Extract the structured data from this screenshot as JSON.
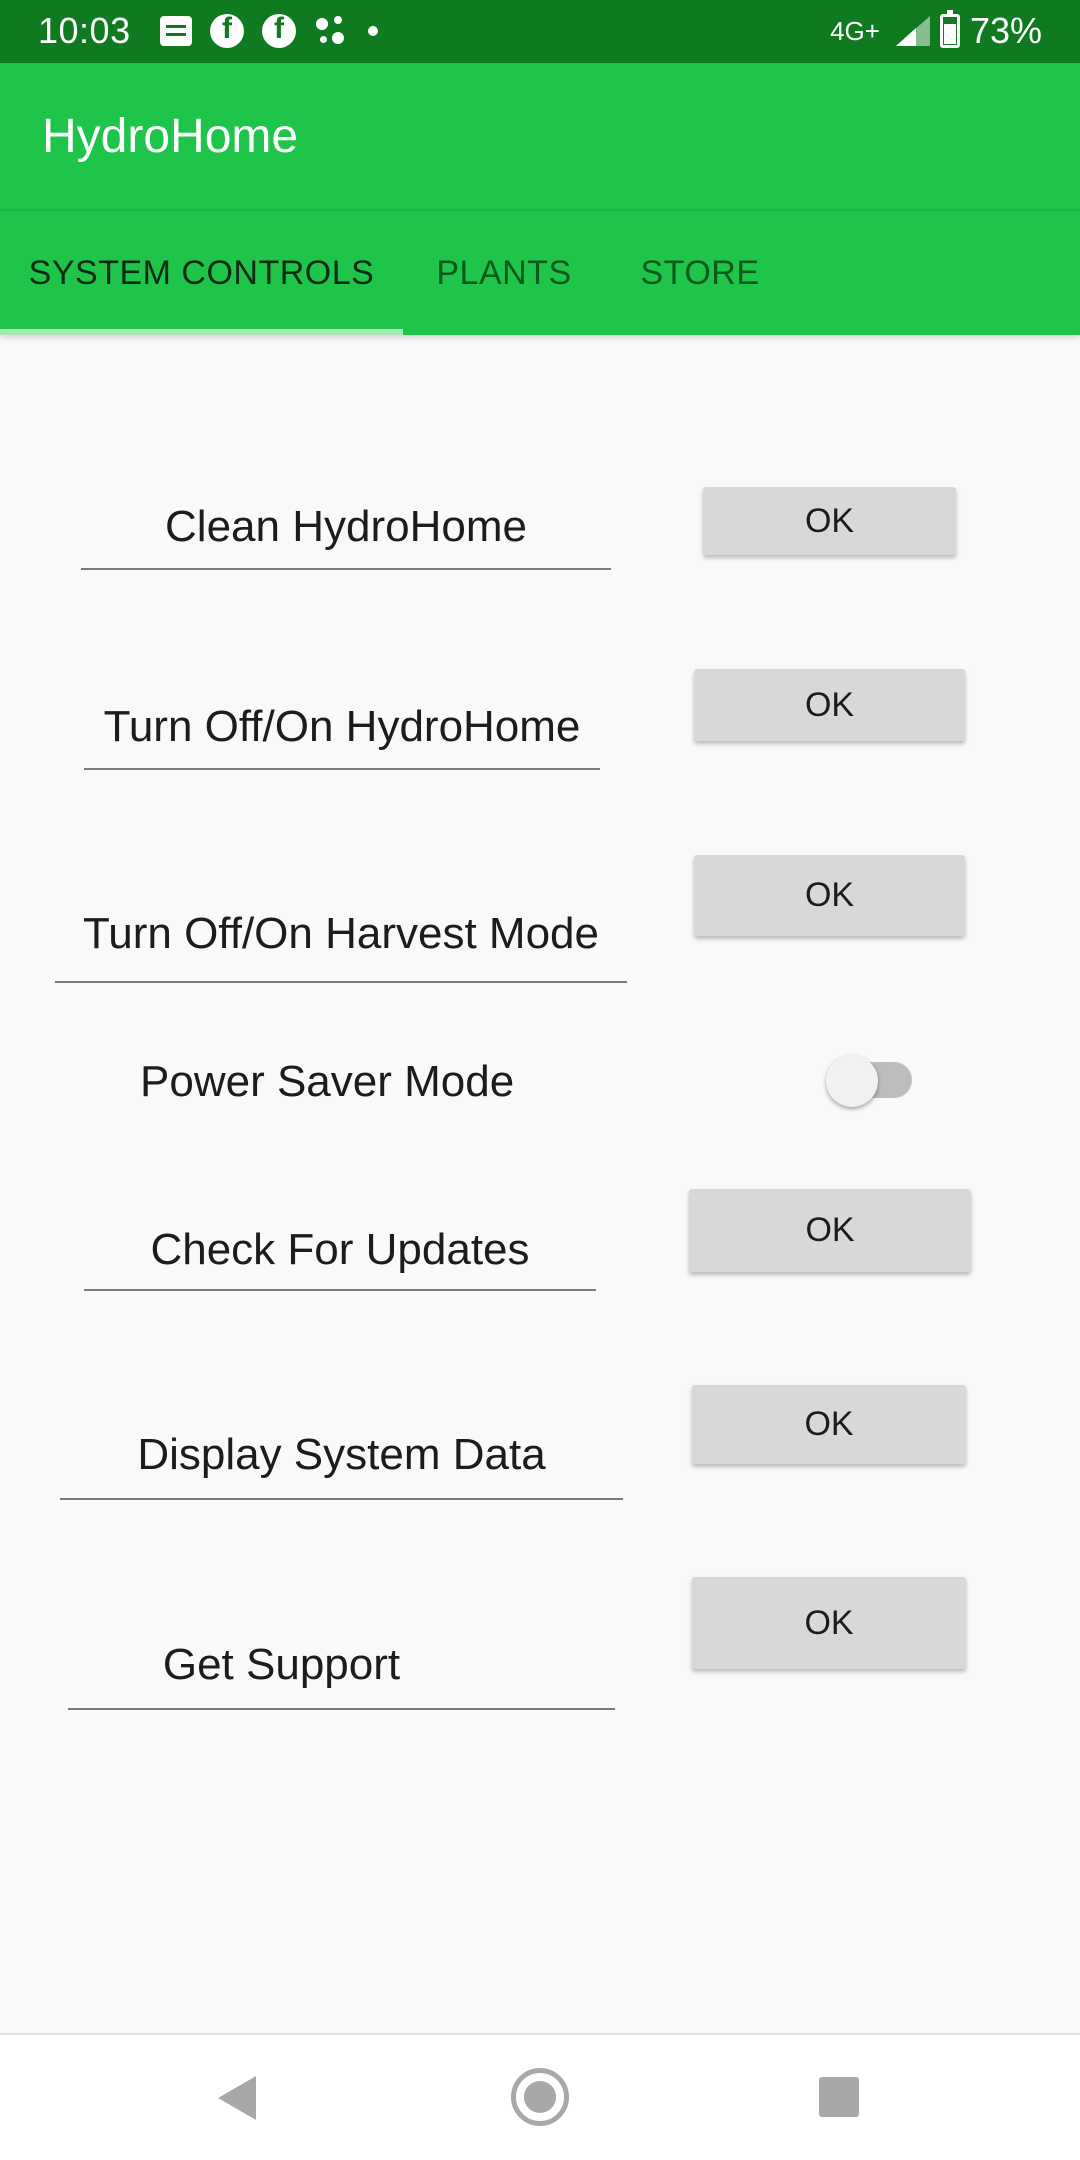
{
  "status_bar": {
    "time": "10:03",
    "network": "4G+",
    "battery": "73%",
    "icons": [
      "message-icon",
      "facebook-icon",
      "facebook-icon",
      "assistant-dots-icon",
      "notification-dot-icon",
      "signal-icon",
      "battery-icon"
    ]
  },
  "app_bar": {
    "title": "HydroHome"
  },
  "tabs": [
    {
      "label": "SYSTEM CONTROLS",
      "active": true
    },
    {
      "label": "PLANTS",
      "active": false
    },
    {
      "label": "STORE",
      "active": false
    }
  ],
  "controls": [
    {
      "label": "Clean HydroHome",
      "button": "OK"
    },
    {
      "label": "Turn Off/On HydroHome",
      "button": "OK"
    },
    {
      "label": "Turn Off/On Harvest Mode",
      "button": "OK"
    },
    {
      "label": "Power Saver Mode",
      "switch_on": false
    },
    {
      "label": "Check For Updates",
      "button": "OK"
    },
    {
      "label": "Display System Data",
      "button": "OK"
    },
    {
      "label": "Get Support",
      "button": "OK"
    }
  ],
  "nav_bar": {
    "icons": [
      "back-icon",
      "home-icon",
      "recents-icon"
    ]
  },
  "colors": {
    "status_bar": "#0f7a20",
    "app_bar": "#1fc54a",
    "background": "#f9f9f9",
    "button": "#d8d8d8"
  }
}
